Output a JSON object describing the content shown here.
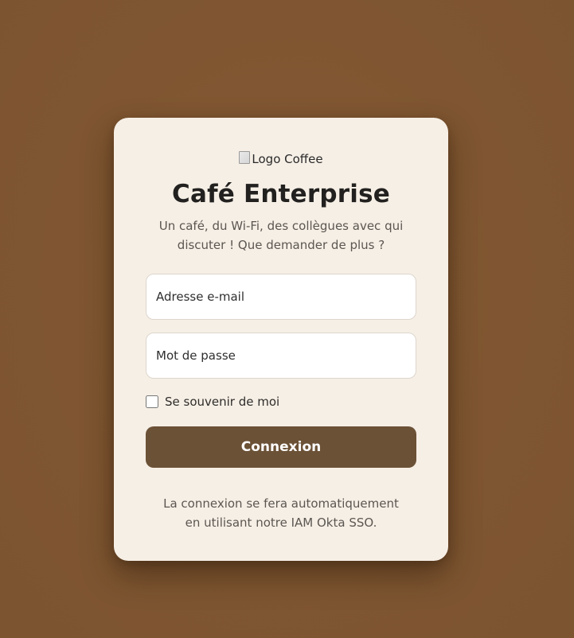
{
  "logo": {
    "alt_text": "Logo Coffee",
    "icon": "broken-image-icon"
  },
  "header": {
    "title": "Café Enterprise",
    "subtitle": "Un café, du Wi-Fi, des collègues avec qui discuter ! Que demander de plus ?"
  },
  "form": {
    "email_placeholder": "Adresse e-mail",
    "email_value": "",
    "password_placeholder": "Mot de passe",
    "password_value": "",
    "remember_label": "Se souvenir de moi",
    "remember_checked": false,
    "submit_label": "Connexion"
  },
  "footer": {
    "note": "La connexion se fera automatiquement en utilisant notre IAM Okta SSO."
  },
  "colors": {
    "background": "#7f5631",
    "card": "#f6efe6",
    "button": "#6b5136",
    "button_text": "#ffffff",
    "title_text": "#22211f",
    "muted_text": "#5b5651"
  }
}
